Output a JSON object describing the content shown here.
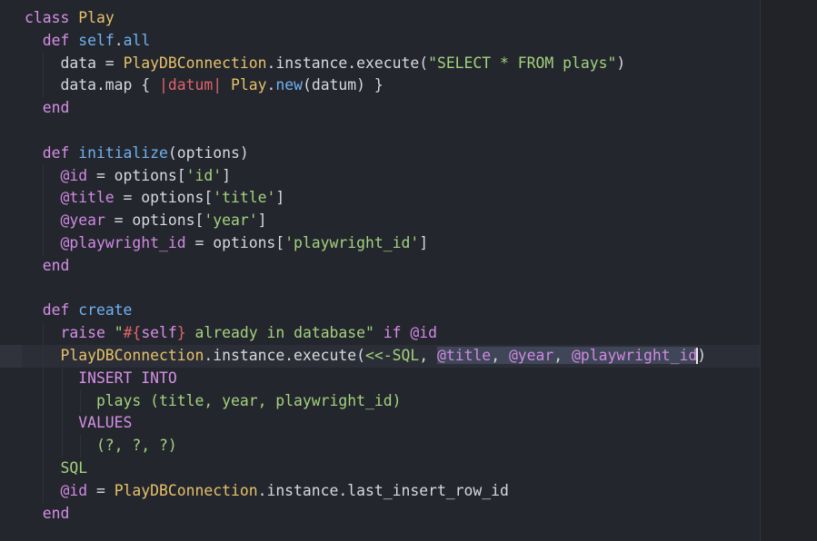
{
  "editor": {
    "colors": {
      "background": "#24262d",
      "keyword": "#d58fe6",
      "class_name": "#e6c16a",
      "function": "#6fb2f2",
      "string": "#a3d27e",
      "text": "#d7d9de",
      "selection": "#3e4657"
    },
    "lines": [
      [
        {
          "t": "class ",
          "c": "kw"
        },
        {
          "t": "Play",
          "c": "cls"
        }
      ],
      [
        {
          "t": "  def ",
          "c": "kw"
        },
        {
          "t": "self",
          "c": "fn"
        },
        {
          "t": ".",
          "c": "plain"
        },
        {
          "t": "all",
          "c": "fn"
        }
      ],
      [
        {
          "t": "    data = ",
          "c": "plain"
        },
        {
          "t": "PlayDBConnection",
          "c": "cls"
        },
        {
          "t": ".instance.execute(",
          "c": "plain"
        },
        {
          "t": "\"SELECT * FROM plays\"",
          "c": "str"
        },
        {
          "t": ")",
          "c": "plain"
        }
      ],
      [
        {
          "t": "    data.map { ",
          "c": "plain"
        },
        {
          "t": "|datum|",
          "c": "err"
        },
        {
          "t": " ",
          "c": "plain"
        },
        {
          "t": "Play",
          "c": "cls"
        },
        {
          "t": ".",
          "c": "plain"
        },
        {
          "t": "new",
          "c": "fn"
        },
        {
          "t": "(datum) }",
          "c": "plain"
        }
      ],
      [
        {
          "t": "  end",
          "c": "kw"
        }
      ],
      [],
      [
        {
          "t": "  def ",
          "c": "kw"
        },
        {
          "t": "initialize",
          "c": "fn"
        },
        {
          "t": "(options)",
          "c": "plain"
        }
      ],
      [
        {
          "t": "    @id",
          "c": "ivar"
        },
        {
          "t": " = options[",
          "c": "plain"
        },
        {
          "t": "'id'",
          "c": "str"
        },
        {
          "t": "]",
          "c": "plain"
        }
      ],
      [
        {
          "t": "    @title",
          "c": "ivar"
        },
        {
          "t": " = options[",
          "c": "plain"
        },
        {
          "t": "'title'",
          "c": "str"
        },
        {
          "t": "]",
          "c": "plain"
        }
      ],
      [
        {
          "t": "    @year",
          "c": "ivar"
        },
        {
          "t": " = options[",
          "c": "plain"
        },
        {
          "t": "'year'",
          "c": "str"
        },
        {
          "t": "]",
          "c": "plain"
        }
      ],
      [
        {
          "t": "    @playwright_id",
          "c": "ivar"
        },
        {
          "t": " = options[",
          "c": "plain"
        },
        {
          "t": "'playwright_id'",
          "c": "str"
        },
        {
          "t": "]",
          "c": "plain"
        }
      ],
      [
        {
          "t": "  end",
          "c": "kw"
        }
      ],
      [],
      [
        {
          "t": "  def ",
          "c": "kw"
        },
        {
          "t": "create",
          "c": "fn"
        }
      ],
      [
        {
          "t": "    raise ",
          "c": "kw"
        },
        {
          "t": "\"",
          "c": "str"
        },
        {
          "t": "#{",
          "c": "err"
        },
        {
          "t": "self",
          "c": "kw"
        },
        {
          "t": "}",
          "c": "err"
        },
        {
          "t": " already in database\"",
          "c": "str"
        },
        {
          "t": " if ",
          "c": "kw"
        },
        {
          "t": "@id",
          "c": "ivar"
        }
      ],
      [
        {
          "t": "    PlayDBConnection",
          "c": "cls"
        },
        {
          "t": ".instance.execute(",
          "c": "plain"
        },
        {
          "t": "<<-SQL",
          "c": "str"
        },
        {
          "t": ", ",
          "c": "plain"
        },
        {
          "t": "@title",
          "c": "ivar",
          "sel": true
        },
        {
          "t": ", ",
          "c": "plain",
          "sel": true
        },
        {
          "t": "@year",
          "c": "ivar",
          "sel": true
        },
        {
          "t": ", ",
          "c": "plain",
          "sel": true
        },
        {
          "t": "@playwright_id",
          "c": "ivar",
          "sel": true,
          "cursor": true
        },
        {
          "t": ")",
          "c": "plain"
        }
      ],
      [
        {
          "t": "      INSERT INTO",
          "c": "sqlkw"
        }
      ],
      [
        {
          "t": "        plays (title, year, playwright_id)",
          "c": "str"
        }
      ],
      [
        {
          "t": "      VALUES",
          "c": "sqlkw"
        }
      ],
      [
        {
          "t": "        (?, ?, ?)",
          "c": "str"
        }
      ],
      [
        {
          "t": "    SQL",
          "c": "str"
        }
      ],
      [
        {
          "t": "    @id",
          "c": "ivar"
        },
        {
          "t": " = ",
          "c": "plain"
        },
        {
          "t": "PlayDBConnection",
          "c": "cls"
        },
        {
          "t": ".instance.last_insert_row_id",
          "c": "plain"
        }
      ],
      [
        {
          "t": "  end",
          "c": "kw"
        }
      ]
    ]
  }
}
